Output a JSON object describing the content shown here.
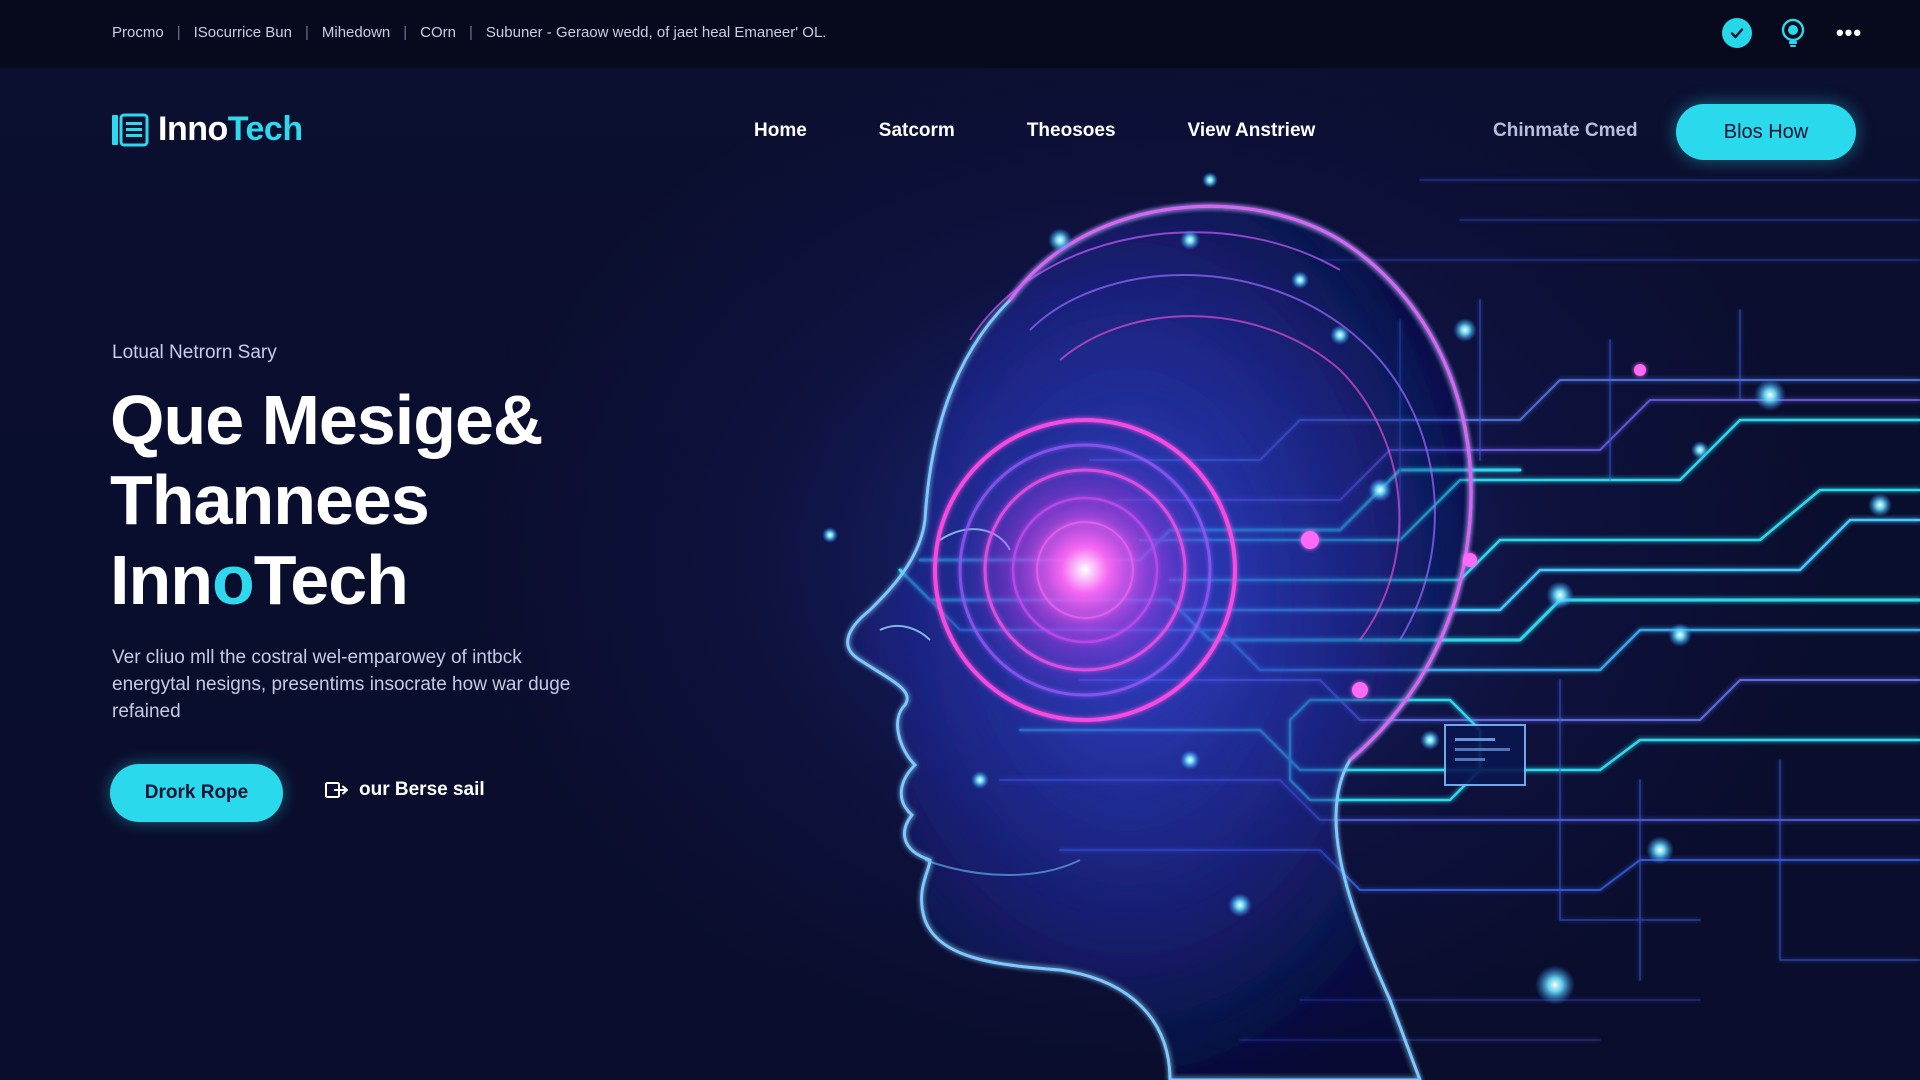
{
  "topbar": {
    "crumbs": [
      "Procmo",
      "ISocurrice Bun",
      "Mihedown",
      "COrn",
      "Subuner - Geraow wedd, of jaet heal Emaneer' OL."
    ],
    "icons": [
      "check-icon",
      "lightbulb-icon",
      "more-icon"
    ]
  },
  "header": {
    "logo": {
      "part1": "Inno",
      "part2": "Tech"
    },
    "nav": [
      "Home",
      "Satcorm",
      "Theosoes",
      "View Anstriew"
    ],
    "link": "Chinmate Cmed",
    "cta": "Blos How"
  },
  "hero": {
    "eyebrow": "Lotual Netrorn Sary",
    "title_line1": "Que Mesige&",
    "title_line2": "Thannees",
    "title_line3_a": "Inn",
    "title_line3_b": "o",
    "title_line3_c": "Tech",
    "description": "Ver cliuo mll the costral wel-emparowey of intbck energytal nesigns, presentims insocrate how war duge refained",
    "primary_button": "Drork Rope",
    "secondary_button": "our Berse sail"
  },
  "colors": {
    "accent": "#2bd9ec",
    "magenta": "#e03cf0",
    "background": "#0a0e2c"
  }
}
